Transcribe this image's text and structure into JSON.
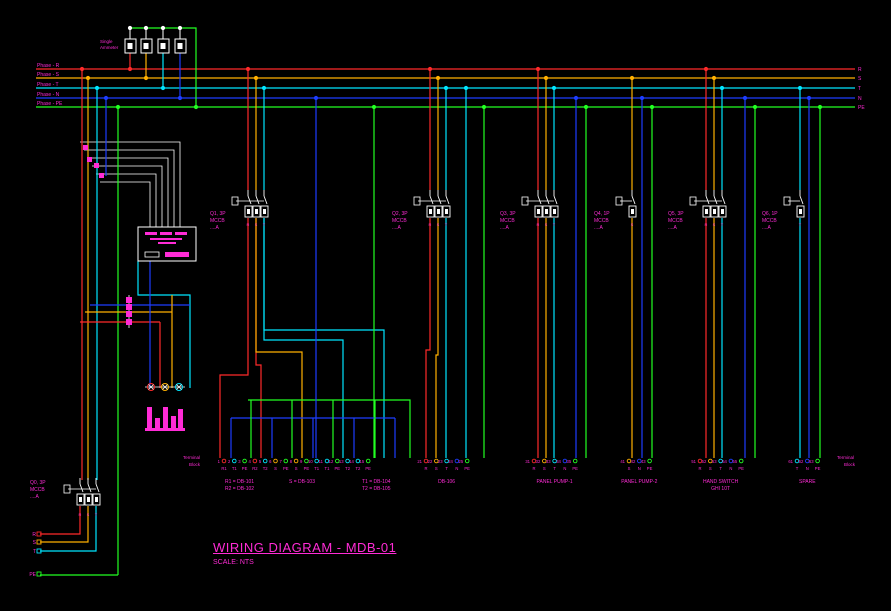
{
  "colors": {
    "R": "#ff2a2a",
    "S": "#ffb000",
    "T": "#00e5ff",
    "N": "#1d3dff",
    "PE": "#22ff22",
    "label": "#ff2bd6",
    "device": "#ffffff"
  },
  "bus": {
    "left_labels": [
      "Phase - R",
      "Phase - S",
      "Phase - T",
      "Phase - N",
      "Phase - PE"
    ],
    "right_labels": [
      "R",
      "S",
      "T",
      "N",
      "PE"
    ]
  },
  "ammeter": {
    "label_line1": "Single",
    "label_line2": "Ammeter"
  },
  "incomer": {
    "name": "Q0, 3P",
    "type": "MCCB",
    "rating": "....A",
    "feed_labels": [
      "R",
      "S",
      "T",
      "PE"
    ]
  },
  "breakers": [
    {
      "name": "Q1, 3P",
      "type": "MCCB",
      "rating": "....A",
      "poles": [
        "R",
        "S",
        "T"
      ]
    },
    {
      "name": "Q2, 3P",
      "type": "MCCB",
      "rating": "....A",
      "poles": [
        "R",
        "S",
        "T"
      ]
    },
    {
      "name": "Q3, 3P",
      "type": "MCCB",
      "rating": "....A",
      "poles": [
        "R",
        "S",
        "T"
      ]
    },
    {
      "name": "Q4, 1P",
      "type": "MCCB",
      "rating": "....A",
      "poles": [
        "S"
      ]
    },
    {
      "name": "Q5, 3P",
      "type": "MCCB",
      "rating": "....A",
      "poles": [
        "R",
        "S",
        "T"
      ]
    },
    {
      "name": "Q6, 1P",
      "type": "MCCB",
      "rating": "....A",
      "poles": [
        "T"
      ]
    }
  ],
  "terminal_block": {
    "line1": "Terminal",
    "line2": "Block"
  },
  "terminal_groups": [
    {
      "numbers": [
        "1",
        "2",
        "3",
        "4",
        "5",
        "6",
        "7",
        "8",
        "9",
        "10",
        "11",
        "12",
        "13",
        "14",
        "15"
      ],
      "phases": [
        "R1",
        "T1",
        "PE",
        "R2",
        "T2",
        "S",
        "PE",
        "S",
        "PE",
        "T1",
        "T1",
        "PE",
        "T2",
        "T2",
        "PE"
      ],
      "captions": [
        "R1 = DB-101",
        "R2 = DB-102",
        "S = DB-103",
        "T1 = DB-104",
        "T2 = DB-105"
      ]
    },
    {
      "numbers": [
        "21",
        "22",
        "23",
        "24",
        "25"
      ],
      "phases": [
        "R",
        "S",
        "T",
        "N",
        "PE"
      ],
      "captions": [
        "DB-106"
      ]
    },
    {
      "numbers": [
        "31",
        "32",
        "33",
        "34",
        "35"
      ],
      "phases": [
        "R",
        "S",
        "T",
        "N",
        "PE"
      ],
      "captions": [
        "PANEL PUMP-1"
      ]
    },
    {
      "numbers": [
        "41",
        "42",
        "43"
      ],
      "phases": [
        "S",
        "N",
        "PE"
      ],
      "captions": [
        "PANEL PUMP-2"
      ]
    },
    {
      "numbers": [
        "51",
        "52",
        "53",
        "54",
        "55"
      ],
      "phases": [
        "R",
        "S",
        "T",
        "N",
        "PE"
      ],
      "captions": [
        "HAND SWITCH",
        "GHI 10T"
      ]
    },
    {
      "numbers": [
        "61",
        "62",
        "63"
      ],
      "phases": [
        "T",
        "N",
        "PE"
      ],
      "captions": [
        "SPARE"
      ]
    }
  ],
  "title_block": {
    "title": "WIRING DIAGRAM - MDB-01",
    "scale": "SCALE: NTS"
  }
}
